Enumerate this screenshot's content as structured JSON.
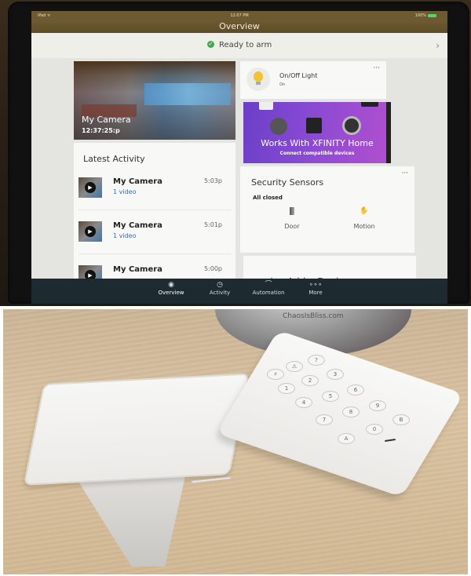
{
  "top_photo": {
    "status_bar": {
      "carrier": "iPad ᯤ",
      "time": "12:07 PM",
      "battery": "100%"
    },
    "nav_title": "Overview",
    "arm_status": {
      "icon": "check-circle-icon",
      "label": "Ready to arm",
      "chevron": "›",
      "color": "#46a74e"
    },
    "camera_card": {
      "name": "My Camera",
      "timestamp": "12:37:25:p"
    },
    "latest_activity": {
      "title": "Latest Activity",
      "items": [
        {
          "name": "My Camera",
          "sub": "1 video",
          "time": "5:03p"
        },
        {
          "name": "My Camera",
          "sub": "1 video",
          "time": "5:01p"
        },
        {
          "name": "My Camera",
          "sub": "",
          "time": "5:00p"
        }
      ]
    },
    "light_card": {
      "name": "On/Off Light",
      "status": "On",
      "more": "···"
    },
    "promo_card": {
      "title": "Works With XFINITY Home",
      "subtitle": "Connect compatible devices"
    },
    "sensors_card": {
      "title": "Security Sensors",
      "status": "All closed",
      "more": "···",
      "sensors": [
        {
          "label": "Door",
          "icon": "door-icon"
        },
        {
          "label": "Motion",
          "icon": "motion-hand-icon"
        }
      ]
    },
    "add_device": {
      "label": "Add a Device"
    },
    "tabs": [
      {
        "label": "Overview",
        "icon": "eye-icon",
        "glyph": "◉",
        "active": true
      },
      {
        "label": "Activity",
        "icon": "clock-icon",
        "glyph": "◷",
        "active": false
      },
      {
        "label": "Automation",
        "icon": "automation-icon",
        "glyph": "⌒",
        "active": false
      },
      {
        "label": "More",
        "icon": "more-dots-icon",
        "glyph": "∘∘∘",
        "active": false
      }
    ],
    "colors": {
      "nav_bar": "#6e5a32",
      "tab_bar": "#1d2a30",
      "link_blue": "#3b6db0",
      "promo_purple": "#8a4ad2"
    }
  },
  "bottom_photo": {
    "watermark": "ChaosIsBliss.com",
    "keypad_keys": [
      "⚡",
      "⚠",
      "?",
      "1",
      "2",
      "3",
      "4",
      "5",
      "6",
      "7",
      "8",
      "9",
      "A",
      "0",
      "B"
    ]
  }
}
